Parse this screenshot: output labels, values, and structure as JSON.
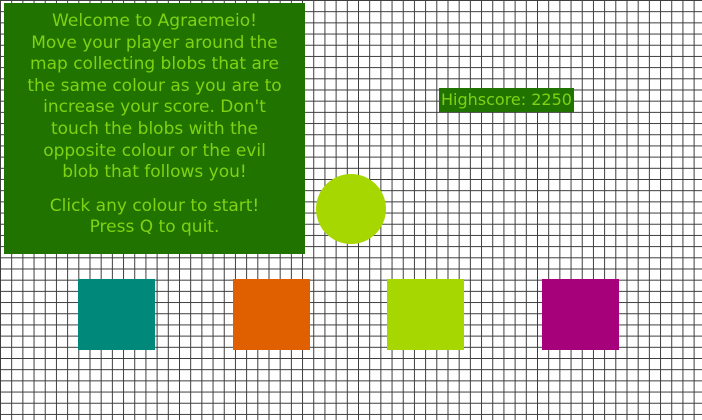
{
  "welcome": {
    "lines": [
      "Welcome to Agraemeio!",
      "Move your player around the",
      "map collecting blobs that are",
      "the same colour as you are to",
      "increase your score. Don't",
      "touch the blobs with the",
      "opposite colour or the evil",
      "blob that follows you!"
    ],
    "start_lines": [
      "Click any colour to start!",
      "Press Q to quit."
    ]
  },
  "highscore": {
    "text": "Highscore: 2250"
  },
  "player": {
    "color": "#a6d700"
  },
  "colour_options": [
    {
      "name": "teal",
      "color": "#00897b"
    },
    {
      "name": "orange",
      "color": "#e06000"
    },
    {
      "name": "lime",
      "color": "#a6d700"
    },
    {
      "name": "magenta",
      "color": "#a6007a"
    }
  ],
  "theme": {
    "panel_bg": "#217300",
    "panel_text": "#7fd312",
    "grid_line": "#3a3a3a",
    "background": "#ffffff"
  }
}
